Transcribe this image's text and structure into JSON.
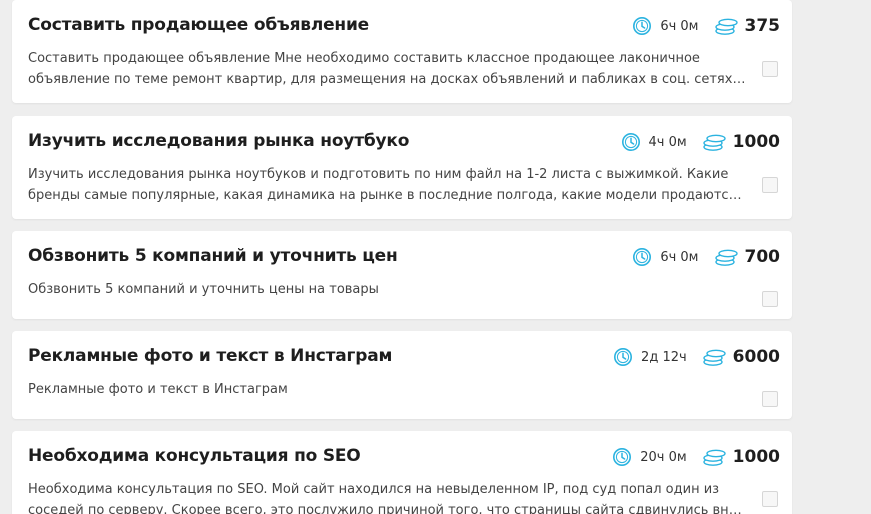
{
  "tasks": [
    {
      "title": "Составить продающее объявление",
      "time": "6ч 0м",
      "price": "375",
      "description": "Составить продающее объявление Мне необходимо составить классное продающее лаконичное объявление по теме ремонт квартир, для размещения на досках объявлений и пабликах в соц. сетях! Нужен легко читаемый разделенн…"
    },
    {
      "title": "Изучить исследования рынка ноутбуко",
      "time": "4ч 0м",
      "price": "1000",
      "description": "Изучить исследования рынка ноутбуков и подготовить по ним файл на 1-2 листа с выжимкой. Какие бренды самые популярные, какая динамика на рынке в последние полгода, какие модели продаются, объем рынка и т.п. Работать…"
    },
    {
      "title": "Обзвонить 5 компаний и уточнить цен",
      "time": "6ч 0м",
      "price": "700",
      "description": "Обзвонить 5 компаний и уточнить цены на товары"
    },
    {
      "title": "Рекламные фото и текст в Инстаграм",
      "time": "2д 12ч",
      "price": "6000",
      "description": "Рекламные фото и текст в Инстаграм"
    },
    {
      "title": "Необходима консультация по SEO",
      "time": "20ч 0м",
      "price": "1000",
      "description": "Необходима консультация по SEO. Мой сайт находился на невыделенном IP, под суд попал один из соседей по серверу. Скорее всего, это послужило причиной того, что страницы сайта сдвинулись вниз в поисковике Yandex (с…"
    }
  ],
  "icons": {
    "time": "clock-icon",
    "price": "coins-icon"
  },
  "colors": {
    "icon_accent": "#2bb3e0",
    "background": "#eeeeee",
    "card": "#ffffff"
  }
}
